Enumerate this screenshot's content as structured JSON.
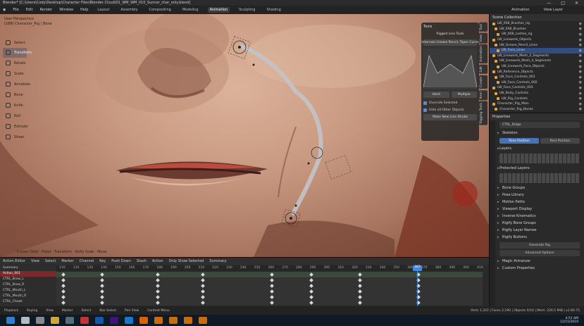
{
  "window": {
    "title": "Blender* [C:\\Users\\Cody\\Desktop\\Character Files\\Blender Cloud\\01_WM_WM_010_Sunner_char_only.blend]",
    "controls": [
      "—",
      "□",
      "✕"
    ]
  },
  "menu": {
    "items": [
      "File",
      "Edit",
      "Render",
      "Window",
      "Help"
    ],
    "workspaces": [
      "Layout",
      "Assembly",
      "Compositing",
      "Modeling",
      "Animation",
      "Sculpting",
      "Shading"
    ],
    "active_workspace": "Animation",
    "scene_label": "Animation",
    "view_layer_label": "View Layer"
  },
  "viewport": {
    "header_line1": "User Perspective",
    "header_line2": "(188) Character_Rig | Bone",
    "tools": [
      "Select",
      "Transform",
      "Rotate",
      "Scale",
      "Annotate",
      "Bone",
      "Knife",
      "Roll",
      "Extrude",
      "Shear"
    ],
    "active_tool": "Transform",
    "footer": "Cursor Orbit  ·  Fixed  ·  Transform  ·  Dolly Grab  ·  Move"
  },
  "tools_panel": {
    "header": "Tools",
    "title": "Rigged Line Tools",
    "mode_button": "Intervals Grease Pencil, Taper Curve",
    "left_button": "Ident",
    "right_button": "Multiple",
    "checkbox1": "Override Selected",
    "checkbox2": "Hide all Other Objects",
    "bottom_button": "Make New Line Stroke"
  },
  "side_tabs": [
    "Tool",
    "View",
    "Animation",
    "Edit",
    "Create",
    "Item",
    "Rigging Tools"
  ],
  "outliner": {
    "header": "Scene Collection",
    "rows": [
      {
        "label": "LW_008_Brushes_rig",
        "selected": false
      },
      {
        "label": "LW_008_Brushes",
        "selected": false
      },
      {
        "label": "LW_008_Lashes_rig",
        "selected": false
      },
      {
        "label": "LW_Linework_Objects",
        "selected": false
      },
      {
        "label": "LW_Grease_Pencil_Lines",
        "selected": false
      },
      {
        "label": "LW_Face_Lines",
        "selected": true
      },
      {
        "label": "LW_Linework_Mesh_2_Segments",
        "selected": false
      },
      {
        "label": "LW_Linework_Mesh_4_Segments",
        "selected": false
      },
      {
        "label": "LW_Linework_Face_Objects",
        "selected": false
      },
      {
        "label": "LW_Reference_Objects",
        "selected": false
      },
      {
        "label": "LW_Face_Controls_001",
        "selected": false
      },
      {
        "label": "LW_Face_Controls_002",
        "selected": false
      },
      {
        "label": "LW_Face_Controls_003",
        "selected": false
      },
      {
        "label": "LW_Body_Controls",
        "selected": false
      },
      {
        "label": "LW_Rig_Controls",
        "selected": false
      },
      {
        "label": "Character_Rig_Main",
        "selected": false
      },
      {
        "label": "Character_Rig_Bones",
        "selected": false
      }
    ]
  },
  "properties": {
    "header": "Properties",
    "object_name": "CTRL_Ridge",
    "section_skeleton": "Skeleton",
    "pose_position": "Pose Position",
    "rest_position": "Rest Position",
    "layers_label": "Layers:",
    "protected_label": "Protected Layers:",
    "sections": [
      "Bone Groups",
      "Pose Library",
      "Motion Paths",
      "Viewport Display",
      "Inverse Kinematics",
      "Rigify Bone Groups",
      "Rigify Layer Names",
      "Rigify Buttons",
      "Magic Armature",
      "Custom Properties"
    ],
    "generate_button": "Generate Rig",
    "advanced_button": "Advanced Options"
  },
  "timeline": {
    "header_items": [
      "Action Editor",
      "View",
      "Select",
      "Marker",
      "Channel",
      "Key",
      "Push Down",
      "Stash",
      "Action",
      "Only Show Selected",
      "Summary"
    ],
    "ruler": [
      "110",
      "120",
      "130",
      "140",
      "150",
      "160",
      "170",
      "180",
      "190",
      "200",
      "210",
      "220",
      "230",
      "240",
      "250",
      "260",
      "270",
      "280",
      "290",
      "300",
      "310",
      "320",
      "330",
      "340",
      "350",
      "360",
      "370",
      "380",
      "390",
      "400",
      "410"
    ],
    "current_frame": "367",
    "channels": [
      {
        "label": "Summary",
        "highlight": false
      },
      {
        "label": "Action_001",
        "highlight": true
      },
      {
        "label": "CTRL_Brow_L",
        "highlight": false
      },
      {
        "label": "CTRL_Brow_R",
        "highlight": false
      },
      {
        "label": "CTRL_Mouth_L",
        "highlight": false
      },
      {
        "label": "CTRL_Mouth_R",
        "highlight": false
      },
      {
        "label": "CTRL_Cheek",
        "highlight": false
      }
    ],
    "keyframe_frames": [
      112,
      140,
      180,
      212,
      262,
      290,
      325,
      367
    ]
  },
  "statusbar": {
    "items": [
      "Playback",
      "Keying",
      "View",
      "Marker",
      "Select",
      "Box Select",
      "Pan View",
      "Context Menu"
    ],
    "version": "Verts 1,322 | Faces 2,190 | Objects 0/16 | Mem: 226.5 MiB | v2.80.75"
  },
  "taskbar": {
    "time": "4:51 AM",
    "date": "12/15/2019",
    "apps": [
      "windows-logo",
      "search",
      "task-view",
      "explorer",
      "calculator",
      "chrome",
      "photoshop",
      "premiere",
      "word",
      "firefox",
      "blender-1",
      "blender-2",
      "blender-3",
      "blender-4"
    ]
  },
  "colors": {
    "accent": "#4772b3",
    "skin": "#c99a82",
    "playhead": "#4a86d9"
  }
}
